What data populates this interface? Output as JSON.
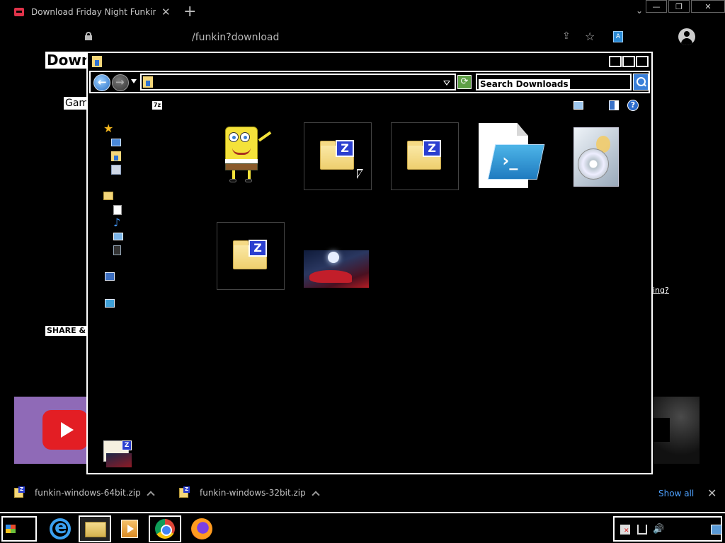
{
  "browser": {
    "tab_title": "Download Friday Night Funkin' by n",
    "tab_close": "✕",
    "new_tab": "+",
    "tab_list": "⌄",
    "url": "/funkin?download",
    "window_controls": {
      "minimize": "—",
      "restore": "❐",
      "close": "✕"
    },
    "icons": [
      "lock-icon",
      "share-icon",
      "star-icon",
      "extension-icon",
      "profile-icon"
    ]
  },
  "page": {
    "heading": "Downl",
    "games_label": "Gam",
    "share_label": "SHARE & F",
    "right_link": "ing?"
  },
  "explorer": {
    "search_placeholder": "Search Downloads",
    "refresh_symbol": "⟳",
    "cmd_7z_label": "7z",
    "help_label": "?",
    "zip_badge": "Z",
    "nav_star": "★",
    "nav_music": "♪",
    "files": [
      {
        "icon": "spongebob-image-icon",
        "type": "image"
      },
      {
        "icon": "zip-folder-icon",
        "type": "zip"
      },
      {
        "icon": "zip-folder-icon",
        "type": "zip"
      },
      {
        "icon": "powershell-script-icon",
        "type": "script"
      },
      {
        "icon": "installer-icon",
        "type": "installer"
      },
      {
        "icon": "zip-folder-icon",
        "type": "zip"
      },
      {
        "icon": "red-cloak-image-icon",
        "type": "image"
      }
    ]
  },
  "downloads_shelf": {
    "items": [
      {
        "name": "funkin-windows-64bit.zip"
      },
      {
        "name": "funkin-windows-32bit.zip"
      }
    ],
    "show_all": "Show all",
    "close": "✕"
  },
  "taskbar": {
    "apps": [
      "internet-explorer",
      "file-explorer",
      "media-player",
      "chrome",
      "firefox"
    ],
    "tray_volume": "🔊"
  }
}
